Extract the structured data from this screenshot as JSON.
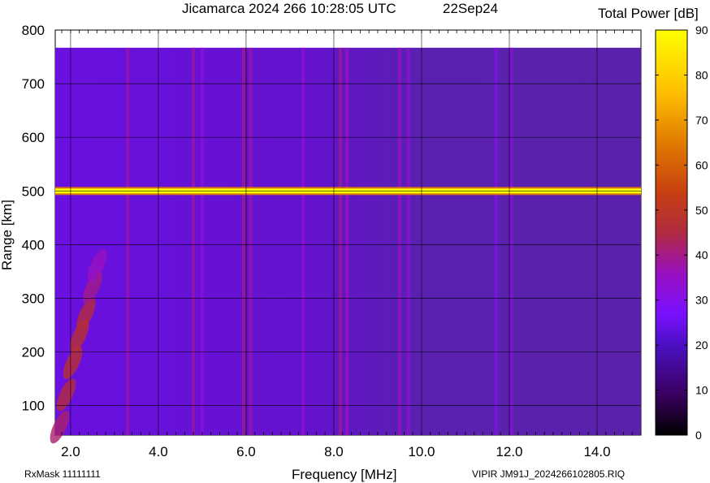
{
  "chart_data": {
    "type": "heatmap",
    "title": "Jicamarca 2024 266 10:28:05 UTC",
    "date_label": "22Sep24",
    "xlabel": "Frequency [MHz]",
    "ylabel": "Range [km]",
    "xlim": [
      1.65,
      15.0
    ],
    "ylim": [
      45,
      800
    ],
    "data_ylim": [
      45,
      767
    ],
    "x_ticks": [
      "2.0",
      "4.0",
      "6.0",
      "8.0",
      "10.0",
      "12.0",
      "14.0"
    ],
    "x_tick_values": [
      2,
      4,
      6,
      8,
      10,
      12,
      14
    ],
    "y_ticks": [
      "100",
      "200",
      "300",
      "400",
      "500",
      "600",
      "700",
      "800"
    ],
    "y_tick_values": [
      100,
      200,
      300,
      400,
      500,
      600,
      700,
      800
    ],
    "grid": true,
    "colorbar": {
      "label": "Total Power [dB]",
      "range": [
        0,
        90
      ],
      "ticks": [
        "0",
        "10",
        "20",
        "30",
        "40",
        "50",
        "60",
        "70",
        "80",
        "90"
      ]
    },
    "colors": {
      "background_low_freq": "#6a10e0",
      "background_high_freq": "#5a20b0",
      "strong_band": "#ffff00",
      "echo": "#c03010"
    },
    "horizontal_band": {
      "range_km": 500,
      "power_db": 90
    },
    "interference_lines": [
      {
        "freq_mhz": 3.3,
        "power_db": 38
      },
      {
        "freq_mhz": 4.8,
        "power_db": 38
      },
      {
        "freq_mhz": 5.0,
        "power_db": 33
      },
      {
        "freq_mhz": 5.95,
        "power_db": 40
      },
      {
        "freq_mhz": 6.1,
        "power_db": 38
      },
      {
        "freq_mhz": 7.3,
        "power_db": 34
      },
      {
        "freq_mhz": 8.15,
        "power_db": 40
      },
      {
        "freq_mhz": 8.3,
        "power_db": 36
      },
      {
        "freq_mhz": 9.5,
        "power_db": 36
      },
      {
        "freq_mhz": 9.7,
        "power_db": 34
      },
      {
        "freq_mhz": 11.7,
        "power_db": 30
      },
      {
        "freq_mhz": 12.05,
        "power_db": 32
      }
    ],
    "ionogram_trace": [
      {
        "freq_mhz": 1.75,
        "range_km": 60,
        "power_db": 42
      },
      {
        "freq_mhz": 1.9,
        "range_km": 120,
        "power_db": 46
      },
      {
        "freq_mhz": 2.05,
        "range_km": 180,
        "power_db": 48
      },
      {
        "freq_mhz": 2.2,
        "range_km": 230,
        "power_db": 48
      },
      {
        "freq_mhz": 2.35,
        "range_km": 270,
        "power_db": 46
      },
      {
        "freq_mhz": 2.5,
        "range_km": 320,
        "power_db": 40
      },
      {
        "freq_mhz": 2.6,
        "range_km": 360,
        "power_db": 36
      }
    ]
  },
  "footer": {
    "left": "RxMask 11111111",
    "right": "VIPIR  JM91J_2024266102805.RIQ"
  }
}
